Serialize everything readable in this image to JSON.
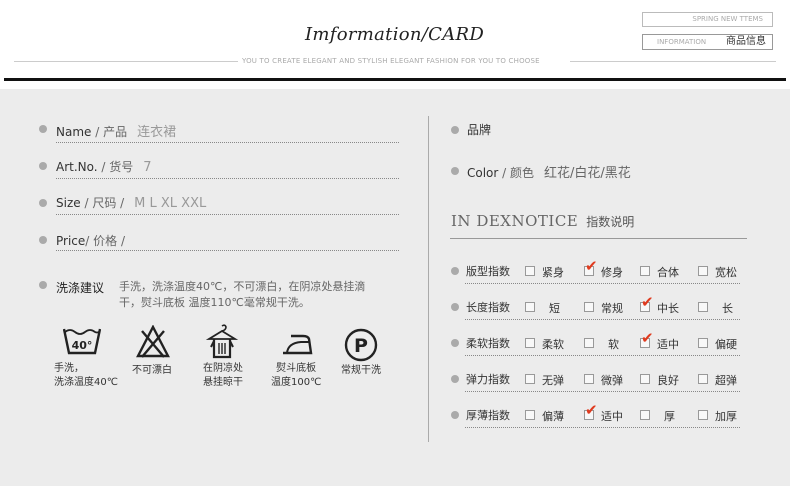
{
  "header": {
    "title": "Imformation/CARD",
    "subtitle": "YOU TO  CREATE ELEGANT AND STYLISH ELEGANT FASHION FOR YOU TO CHOOSE",
    "spring_box": "SPRING  NEW TTEMS",
    "info_box_en": "INFORMATION",
    "info_box_cn": "商品信息"
  },
  "left": {
    "name": {
      "en": "Name",
      "sep": " / ",
      "cn": "产品",
      "value": "连衣裙"
    },
    "artno": {
      "en": "Art.No.",
      "sep": " / ",
      "cn": "货号",
      "value": "7"
    },
    "size": {
      "en": "Size",
      "sep": " / ",
      "cn": "尺码 /",
      "value": "M  L  XL  XXL"
    },
    "price": {
      "en": "Price",
      "sep": "/ ",
      "cn": "价格 /",
      "value": ""
    },
    "wash": {
      "label": "洗涤建议",
      "text": "手洗，洗涤温度40℃，不可漂白，在阴凉处悬挂滴干，熨斗底板 温度110℃毫常规干洗。"
    },
    "care_icons": [
      {
        "icon": "wash-tub-icon",
        "tub_text": "40°",
        "caption_line1": "手洗，",
        "caption_line2": "洗涤温度40℃"
      },
      {
        "icon": "no-bleach-icon",
        "caption_line1": "不可漂白",
        "caption_line2": ""
      },
      {
        "icon": "hang-dry-icon",
        "caption_line1": "在阴凉处",
        "caption_line2": "悬挂晾干"
      },
      {
        "icon": "iron-icon",
        "caption_line1": "熨斗底板",
        "caption_line2": "温度100℃"
      },
      {
        "icon": "dry-clean-p-icon",
        "circle_text": "P",
        "caption_line1": "常规干洗",
        "caption_line2": ""
      }
    ]
  },
  "right": {
    "brand": {
      "cn": "品牌"
    },
    "color": {
      "en": "Color",
      "sep": " / ",
      "cn": "颜色",
      "value": "红花/白花/黑花"
    },
    "index_title_en": "IN DEXNOTICE",
    "index_title_cn": "指数说明",
    "rows": [
      {
        "label": "版型指数",
        "options": [
          "紧身",
          "修身",
          "合体",
          "宽松"
        ],
        "checked": 1
      },
      {
        "label": "长度指数",
        "options": [
          "短",
          "常规",
          "中长",
          "长"
        ],
        "checked": 2
      },
      {
        "label": "柔软指数",
        "options": [
          "柔软",
          "软",
          "适中",
          "偏硬"
        ],
        "checked": 2
      },
      {
        "label": "弹力指数",
        "options": [
          "无弹",
          "微弹",
          "良好",
          "超弹"
        ],
        "checked": -1
      },
      {
        "label": "厚薄指数",
        "options": [
          "偏薄",
          "适中",
          "厚",
          "加厚"
        ],
        "checked": 1
      }
    ],
    "check_mark": "✔"
  },
  "colors": {
    "accent": "#e03a1e",
    "panel": "#ececec"
  }
}
